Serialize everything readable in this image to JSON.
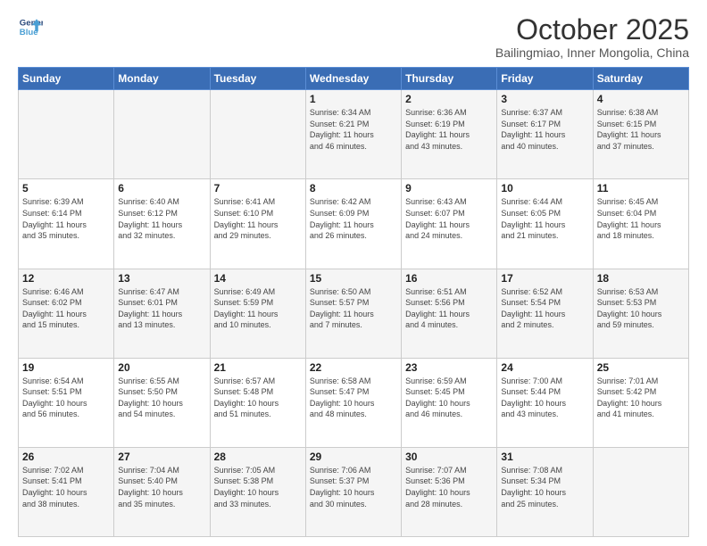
{
  "logo": {
    "line1": "General",
    "line2": "Blue"
  },
  "title": "October 2025",
  "subtitle": "Bailingmiao, Inner Mongolia, China",
  "days_of_week": [
    "Sunday",
    "Monday",
    "Tuesday",
    "Wednesday",
    "Thursday",
    "Friday",
    "Saturday"
  ],
  "weeks": [
    [
      {
        "day": "",
        "info": ""
      },
      {
        "day": "",
        "info": ""
      },
      {
        "day": "",
        "info": ""
      },
      {
        "day": "1",
        "info": "Sunrise: 6:34 AM\nSunset: 6:21 PM\nDaylight: 11 hours\nand 46 minutes."
      },
      {
        "day": "2",
        "info": "Sunrise: 6:36 AM\nSunset: 6:19 PM\nDaylight: 11 hours\nand 43 minutes."
      },
      {
        "day": "3",
        "info": "Sunrise: 6:37 AM\nSunset: 6:17 PM\nDaylight: 11 hours\nand 40 minutes."
      },
      {
        "day": "4",
        "info": "Sunrise: 6:38 AM\nSunset: 6:15 PM\nDaylight: 11 hours\nand 37 minutes."
      }
    ],
    [
      {
        "day": "5",
        "info": "Sunrise: 6:39 AM\nSunset: 6:14 PM\nDaylight: 11 hours\nand 35 minutes."
      },
      {
        "day": "6",
        "info": "Sunrise: 6:40 AM\nSunset: 6:12 PM\nDaylight: 11 hours\nand 32 minutes."
      },
      {
        "day": "7",
        "info": "Sunrise: 6:41 AM\nSunset: 6:10 PM\nDaylight: 11 hours\nand 29 minutes."
      },
      {
        "day": "8",
        "info": "Sunrise: 6:42 AM\nSunset: 6:09 PM\nDaylight: 11 hours\nand 26 minutes."
      },
      {
        "day": "9",
        "info": "Sunrise: 6:43 AM\nSunset: 6:07 PM\nDaylight: 11 hours\nand 24 minutes."
      },
      {
        "day": "10",
        "info": "Sunrise: 6:44 AM\nSunset: 6:05 PM\nDaylight: 11 hours\nand 21 minutes."
      },
      {
        "day": "11",
        "info": "Sunrise: 6:45 AM\nSunset: 6:04 PM\nDaylight: 11 hours\nand 18 minutes."
      }
    ],
    [
      {
        "day": "12",
        "info": "Sunrise: 6:46 AM\nSunset: 6:02 PM\nDaylight: 11 hours\nand 15 minutes."
      },
      {
        "day": "13",
        "info": "Sunrise: 6:47 AM\nSunset: 6:01 PM\nDaylight: 11 hours\nand 13 minutes."
      },
      {
        "day": "14",
        "info": "Sunrise: 6:49 AM\nSunset: 5:59 PM\nDaylight: 11 hours\nand 10 minutes."
      },
      {
        "day": "15",
        "info": "Sunrise: 6:50 AM\nSunset: 5:57 PM\nDaylight: 11 hours\nand 7 minutes."
      },
      {
        "day": "16",
        "info": "Sunrise: 6:51 AM\nSunset: 5:56 PM\nDaylight: 11 hours\nand 4 minutes."
      },
      {
        "day": "17",
        "info": "Sunrise: 6:52 AM\nSunset: 5:54 PM\nDaylight: 11 hours\nand 2 minutes."
      },
      {
        "day": "18",
        "info": "Sunrise: 6:53 AM\nSunset: 5:53 PM\nDaylight: 10 hours\nand 59 minutes."
      }
    ],
    [
      {
        "day": "19",
        "info": "Sunrise: 6:54 AM\nSunset: 5:51 PM\nDaylight: 10 hours\nand 56 minutes."
      },
      {
        "day": "20",
        "info": "Sunrise: 6:55 AM\nSunset: 5:50 PM\nDaylight: 10 hours\nand 54 minutes."
      },
      {
        "day": "21",
        "info": "Sunrise: 6:57 AM\nSunset: 5:48 PM\nDaylight: 10 hours\nand 51 minutes."
      },
      {
        "day": "22",
        "info": "Sunrise: 6:58 AM\nSunset: 5:47 PM\nDaylight: 10 hours\nand 48 minutes."
      },
      {
        "day": "23",
        "info": "Sunrise: 6:59 AM\nSunset: 5:45 PM\nDaylight: 10 hours\nand 46 minutes."
      },
      {
        "day": "24",
        "info": "Sunrise: 7:00 AM\nSunset: 5:44 PM\nDaylight: 10 hours\nand 43 minutes."
      },
      {
        "day": "25",
        "info": "Sunrise: 7:01 AM\nSunset: 5:42 PM\nDaylight: 10 hours\nand 41 minutes."
      }
    ],
    [
      {
        "day": "26",
        "info": "Sunrise: 7:02 AM\nSunset: 5:41 PM\nDaylight: 10 hours\nand 38 minutes."
      },
      {
        "day": "27",
        "info": "Sunrise: 7:04 AM\nSunset: 5:40 PM\nDaylight: 10 hours\nand 35 minutes."
      },
      {
        "day": "28",
        "info": "Sunrise: 7:05 AM\nSunset: 5:38 PM\nDaylight: 10 hours\nand 33 minutes."
      },
      {
        "day": "29",
        "info": "Sunrise: 7:06 AM\nSunset: 5:37 PM\nDaylight: 10 hours\nand 30 minutes."
      },
      {
        "day": "30",
        "info": "Sunrise: 7:07 AM\nSunset: 5:36 PM\nDaylight: 10 hours\nand 28 minutes."
      },
      {
        "day": "31",
        "info": "Sunrise: 7:08 AM\nSunset: 5:34 PM\nDaylight: 10 hours\nand 25 minutes."
      },
      {
        "day": "",
        "info": ""
      }
    ]
  ]
}
